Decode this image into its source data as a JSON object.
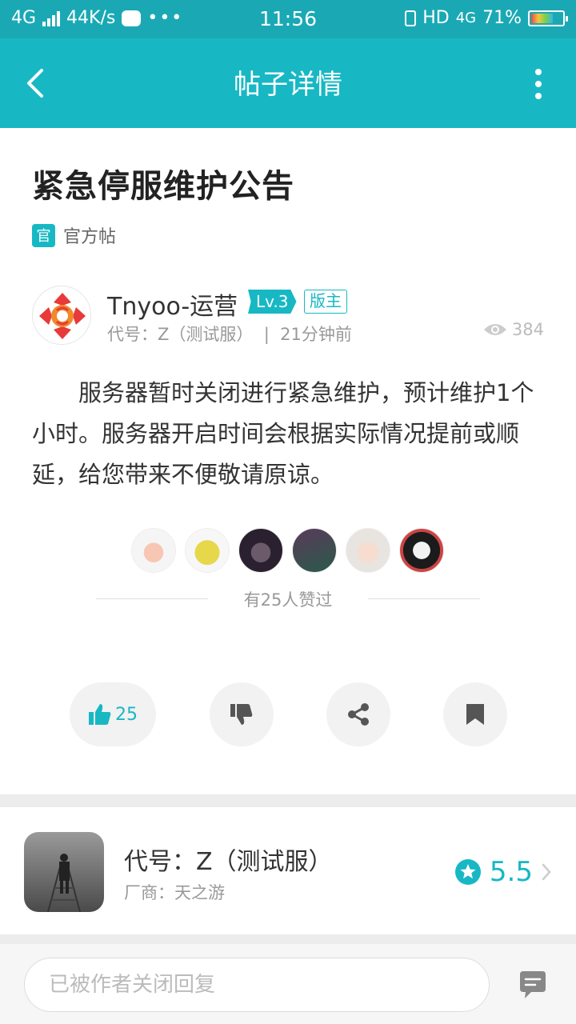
{
  "status_bar": {
    "network": "4G",
    "speed": "44K/s",
    "time": "11:56",
    "hd": "HD",
    "network_right": "4G",
    "battery": "71%",
    "battery_level": 0.71
  },
  "app_bar": {
    "title": "帖子详情"
  },
  "post": {
    "title": "紧急停服维护公告",
    "official_badge": "官",
    "official_label": "官方帖",
    "author": {
      "name": "Tnyoo-运营",
      "level": "Lv.3",
      "role": "版主"
    },
    "meta": "代号：Z（测试服）  |  21分钟前",
    "views": "384",
    "content": "服务器暂时关闭进行紧急维护，预计维护1个小时。服务器开启时间会根据实际情况提前或顺延，给您带来不便敬请原谅。",
    "likes_text": "有25人赞过",
    "like_count": "25"
  },
  "game": {
    "name": "代号：Z（测试服）",
    "vendor": "厂商：天之游",
    "rating": "5.5"
  },
  "reply": {
    "placeholder": "已被作者关闭回复"
  },
  "colors": {
    "accent": "#17b8c4",
    "status_bar": "#1aa9b4"
  }
}
